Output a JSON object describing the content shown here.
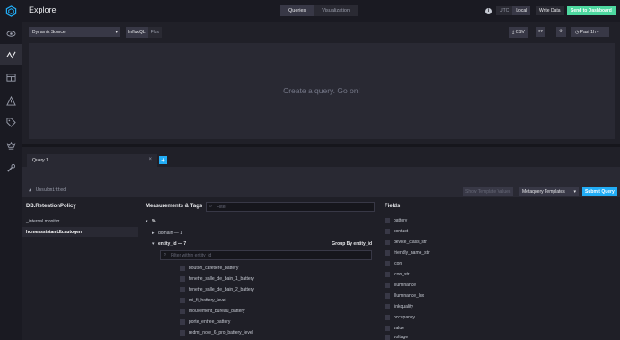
{
  "nav": {
    "items": [
      {
        "icon": "eye-icon",
        "active": false
      },
      {
        "icon": "explore-icon",
        "active": true
      },
      {
        "icon": "dashboards-icon",
        "active": false
      },
      {
        "icon": "alert-icon",
        "active": false
      },
      {
        "icon": "tag-icon",
        "active": false
      },
      {
        "icon": "crown-icon",
        "active": false
      },
      {
        "icon": "wrench-icon",
        "active": false
      }
    ]
  },
  "header": {
    "title": "Explore",
    "views": [
      "Queries",
      "Visualization"
    ],
    "info": "i",
    "tz": [
      "UTC",
      "Local"
    ],
    "write_label": "Write Data",
    "send_label": "Send to Dashboard"
  },
  "toolbar": {
    "source": "Dynamic Source",
    "lang": [
      "InfluxQL",
      "Flux"
    ],
    "csv_label": "CSV",
    "time_label": "Past 1h"
  },
  "graph": {
    "placeholder": "Create a query. Go on!"
  },
  "query": {
    "tab_label": "Query 1",
    "add_label": "+",
    "status": "Unsubmitted",
    "template_label": "Show Template Values",
    "metaquery_label": "Metaquery Templates",
    "submit_label": "Submit Query"
  },
  "explorer": {
    "db_header": "DB.RetentionPolicy",
    "databases": [
      "_internal.monitor",
      "homeassistantdb.autogen"
    ],
    "meas_header": "Measurements & Tags",
    "meas_filter_placeholder": "Filter",
    "measurement": "%",
    "domain_row": "domain — 1",
    "entity_row": "entity_id — 7",
    "group_by": "Group By entity_id",
    "entity_filter_placeholder": "Filter within entity_id",
    "tags": [
      "bouton_cafetiere_battery",
      "fenetre_salle_de_bain_1_battery",
      "fenetre_salle_de_bain_2_battery",
      "mi_fi_battery_level",
      "mouvement_bureau_battery",
      "porte_entree_battery",
      "redmi_note_6_pro_battery_level"
    ],
    "fields_header": "Fields",
    "fields": [
      "battery",
      "contact",
      "device_class_str",
      "friendly_name_str",
      "icon",
      "icon_str",
      "illuminance",
      "illuminance_lux",
      "linkquality",
      "occupancy",
      "value",
      "voltage"
    ]
  }
}
